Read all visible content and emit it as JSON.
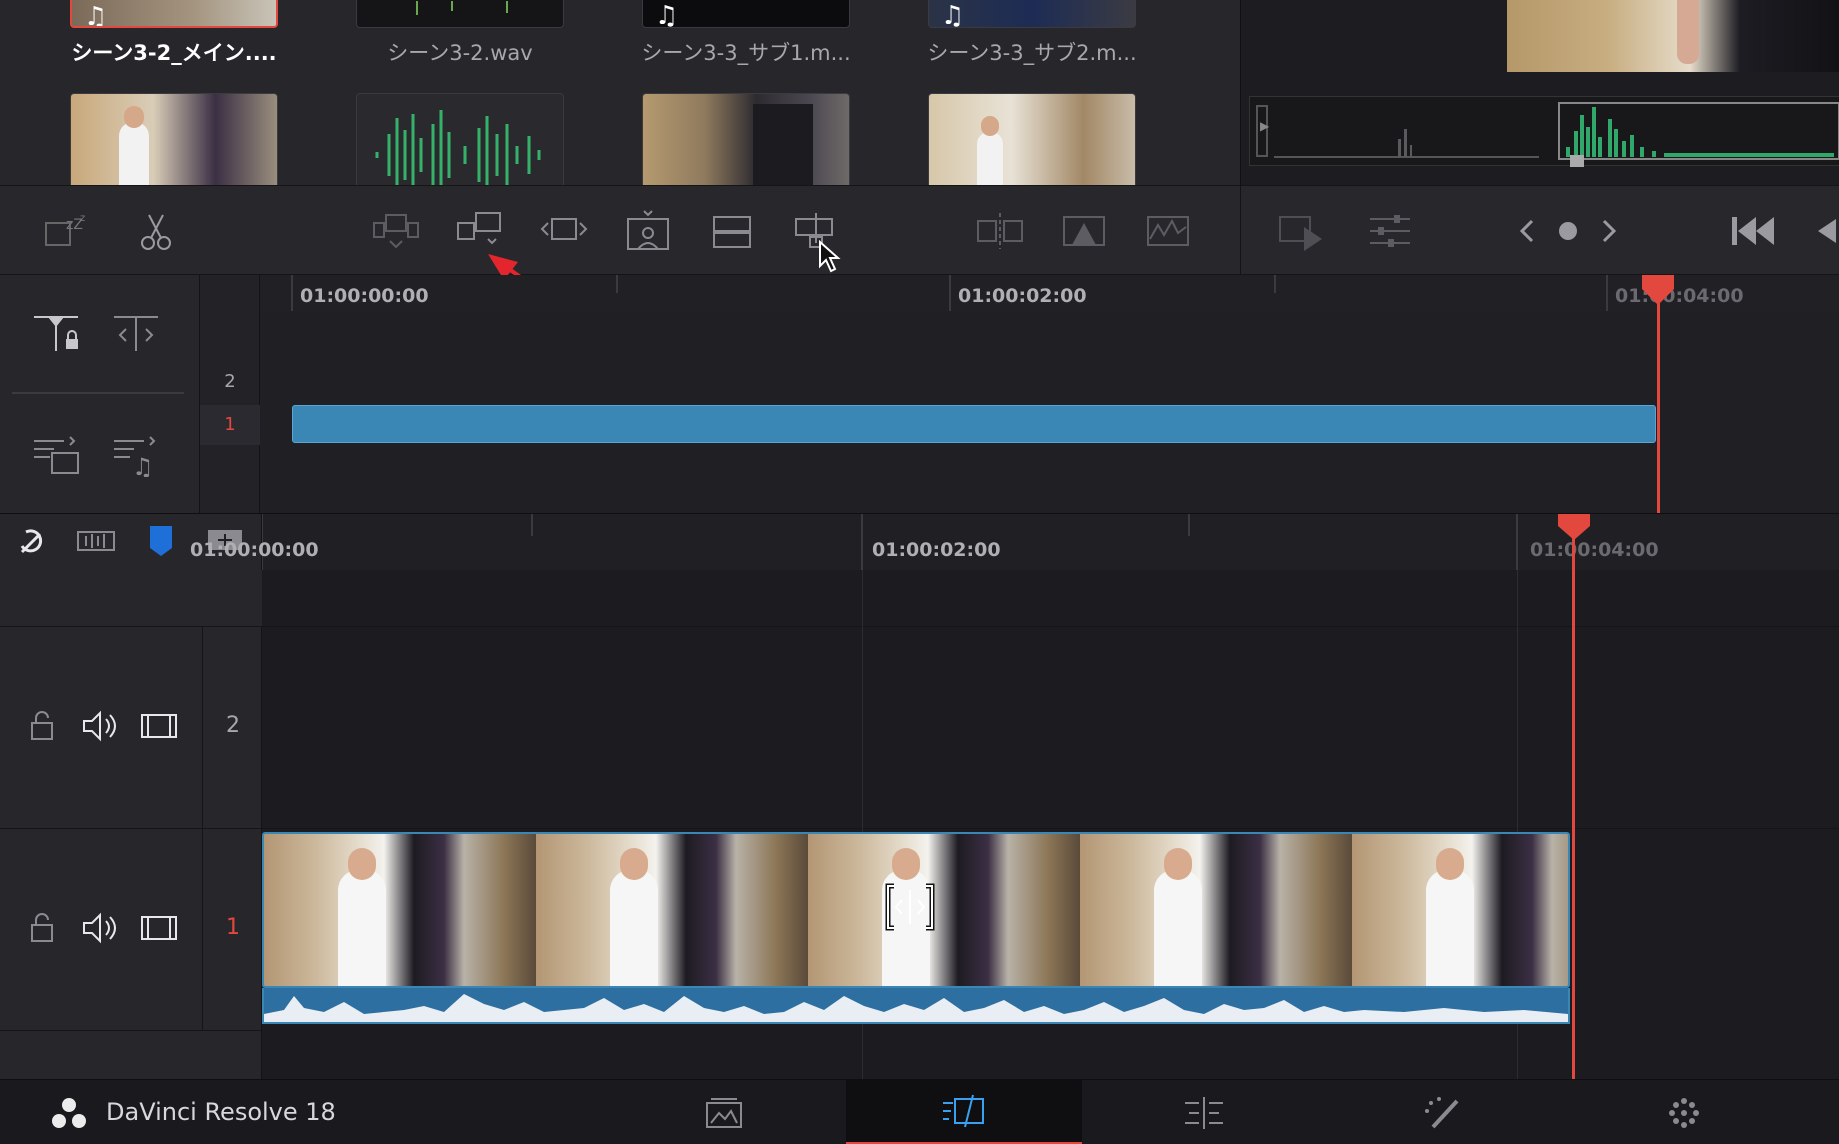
{
  "media_pool": {
    "clips_row1": [
      {
        "name": "シーン3-2_メイン....",
        "selected": true
      },
      {
        "name": "シーン3-2.wav",
        "selected": false
      },
      {
        "name": "シーン3-3_サブ1.m...",
        "selected": false
      },
      {
        "name": "シーン3-3_サブ2.m...",
        "selected": false
      }
    ]
  },
  "upper_timeline": {
    "timecodes": [
      "01:00:00:00",
      "01:00:02:00",
      "01:00:04:00"
    ],
    "tracks": [
      "2",
      "1"
    ],
    "active_track": "1"
  },
  "lower_timeline": {
    "timecodes": [
      "01:00:00:00",
      "01:00:02:00",
      "01:00:04:00"
    ],
    "tracks": [
      "2",
      "1"
    ],
    "active_track": "1"
  },
  "bottom_bar": {
    "app_name": "DaVinci Resolve 18",
    "pages": [
      "media",
      "cut",
      "edit",
      "fusion",
      "color"
    ],
    "active_page": "cut"
  },
  "colors": {
    "accent": "#e2483d",
    "clip_blue": "#3a86b5",
    "audio_green": "#2fa86a"
  }
}
